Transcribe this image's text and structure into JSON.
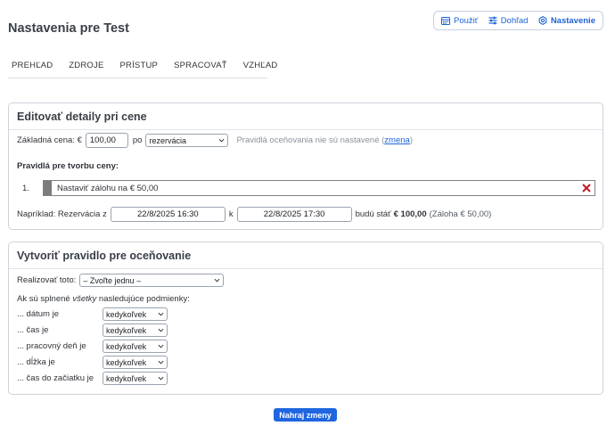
{
  "page": {
    "title": "Nastavenia pre Test"
  },
  "topnav": {
    "items": [
      {
        "label": "Použiť",
        "icon": "calendar-icon"
      },
      {
        "label": "Dohľad",
        "icon": "sliders-icon"
      },
      {
        "label": "Nastavenie",
        "icon": "gear-icon",
        "active": true
      }
    ],
    "accent": "#1d63d6"
  },
  "tabs": [
    "PREHĽAD",
    "ZDROJE",
    "PRÍSTUP",
    "SPRACOVAŤ",
    "VZHĽAD"
  ],
  "edit_panel": {
    "title": "Editovať detaily pri cene",
    "base_price_label": "Základná cena: €",
    "base_price_value": "100,00",
    "per_label": "po",
    "per_select": "rezervácia",
    "rules_status_text": "Pravidlá oceňovania nie sú nastavené (",
    "rules_status_link": "zmena",
    "rules_status_close": ")",
    "rules_heading": "Pravidlá pre tvorbu ceny:",
    "rules": [
      {
        "num": "1.",
        "text": "Nastaviť zálohu na € 50,00"
      }
    ],
    "example": {
      "prefix": "Napríklad: Rezervácia z",
      "from_value": "22/8/2025 16:30",
      "to_label": "k",
      "to_value": "22/8/2025 17:30",
      "will_cost": "budú stáť",
      "total": "€ 100,00",
      "deposit": "(Záloha € 50,00)"
    }
  },
  "create_panel": {
    "title": "Vytvoriť pravidlo pre oceňovanie",
    "action_label": "Realizovať toto:",
    "action_select": "– Zvoľte jednu –",
    "conditions_intro_pre": "Ak sú splnené ",
    "conditions_intro_em": "všetky",
    "conditions_intro_post": " nasledujúce podmienky:",
    "conditions": [
      {
        "label": "... dátum je",
        "value": "kedykoľvek"
      },
      {
        "label": "... čas je",
        "value": "kedykoľvek"
      },
      {
        "label": "... pracovný deň je",
        "value": "kedykoľvek"
      },
      {
        "label": "... dĺžka je",
        "value": "kedykoľvek"
      },
      {
        "label": "... čas do začiatku je",
        "value": "kedykoľvek"
      }
    ]
  },
  "save_label": "Nahraj zmeny",
  "colors": {
    "delete": "#c41a2b",
    "button": "#1f66e0"
  }
}
